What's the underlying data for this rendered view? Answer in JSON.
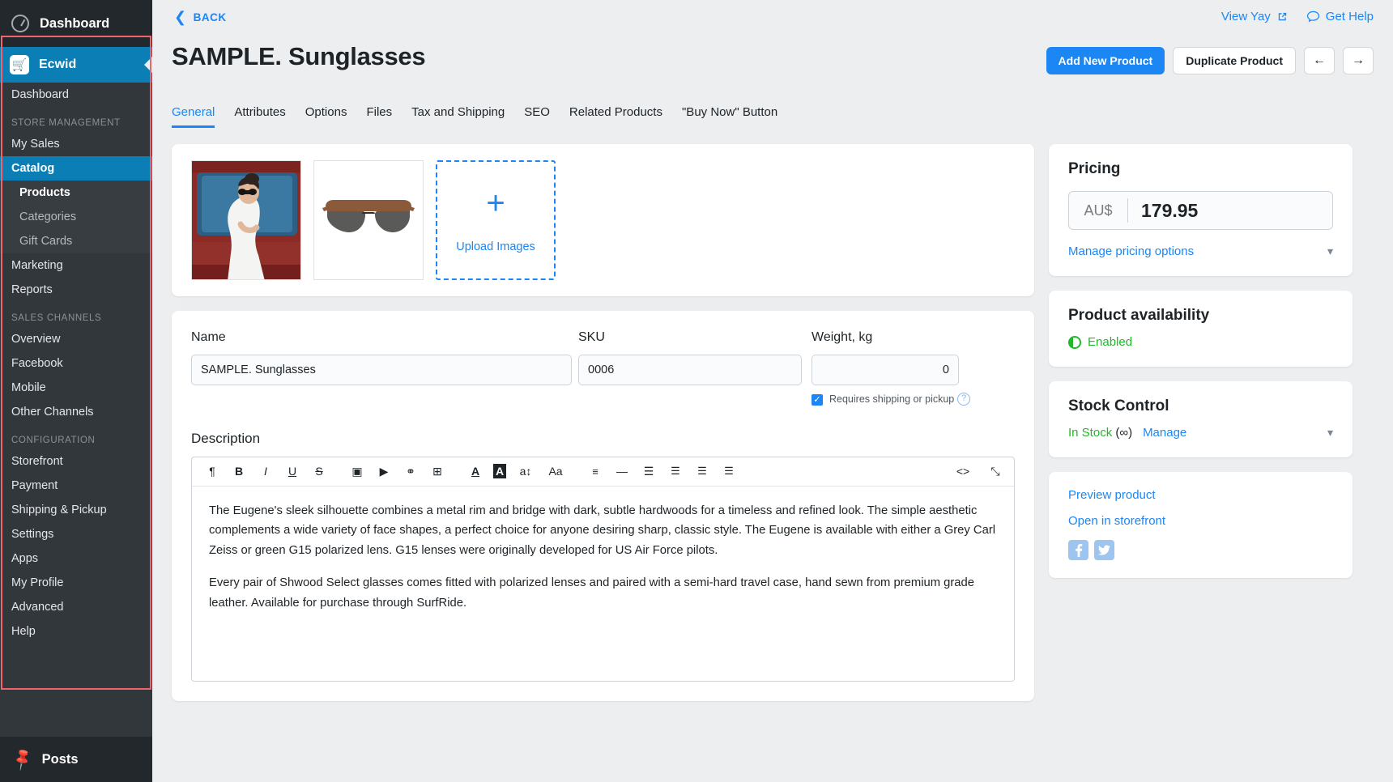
{
  "sidebar": {
    "wp_dashboard": "Dashboard",
    "ecwid": "Ecwid",
    "items": [
      {
        "label": "Dashboard",
        "type": "item"
      },
      {
        "label": "STORE MANAGEMENT",
        "type": "group"
      },
      {
        "label": "My Sales",
        "type": "item"
      },
      {
        "label": "Catalog",
        "type": "selected"
      },
      {
        "label": "Products",
        "type": "sub-active"
      },
      {
        "label": "Categories",
        "type": "sub"
      },
      {
        "label": "Gift Cards",
        "type": "sub"
      },
      {
        "label": "Marketing",
        "type": "item"
      },
      {
        "label": "Reports",
        "type": "item"
      },
      {
        "label": "SALES CHANNELS",
        "type": "group"
      },
      {
        "label": "Overview",
        "type": "item"
      },
      {
        "label": "Facebook",
        "type": "item"
      },
      {
        "label": "Mobile",
        "type": "item"
      },
      {
        "label": "Other Channels",
        "type": "item"
      },
      {
        "label": "CONFIGURATION",
        "type": "group"
      },
      {
        "label": "Storefront",
        "type": "item"
      },
      {
        "label": "Payment",
        "type": "item"
      },
      {
        "label": "Shipping & Pickup",
        "type": "item"
      },
      {
        "label": "Settings",
        "type": "item"
      },
      {
        "label": "Apps",
        "type": "item"
      },
      {
        "label": "My Profile",
        "type": "item"
      },
      {
        "label": "Advanced",
        "type": "item"
      },
      {
        "label": "Help",
        "type": "item"
      }
    ],
    "posts": "Posts",
    "highlight_color": "#f0646b",
    "accent_color": "#0b7fb5"
  },
  "header": {
    "back": "BACK",
    "title": "SAMPLE. Sunglasses",
    "view_store": "View Yay",
    "get_help": "Get Help",
    "add_new_product": "Add New Product",
    "duplicate_product": "Duplicate Product",
    "prev_arrow": "←",
    "next_arrow": "→"
  },
  "tabs": [
    {
      "label": "General",
      "active": true
    },
    {
      "label": "Attributes",
      "active": false
    },
    {
      "label": "Options",
      "active": false
    },
    {
      "label": "Files",
      "active": false
    },
    {
      "label": "Tax and Shipping",
      "active": false
    },
    {
      "label": "SEO",
      "active": false
    },
    {
      "label": "Related Products",
      "active": false
    },
    {
      "label": "\"Buy Now\" Button",
      "active": false
    }
  ],
  "images": {
    "upload_label": "Upload Images",
    "plus": "+"
  },
  "fields": {
    "name_label": "Name",
    "name_value": "SAMPLE. Sunglasses",
    "sku_label": "SKU",
    "sku_value": "0006",
    "weight_label": "Weight, kg",
    "weight_value": "0",
    "requires_shipping": "Requires shipping or pickup",
    "help_glyph": "?",
    "check_glyph": "✓"
  },
  "description": {
    "label": "Description",
    "toolbar": [
      {
        "name": "paragraph-icon",
        "glyph": "¶"
      },
      {
        "name": "bold-icon",
        "glyph": "B"
      },
      {
        "name": "italic-icon",
        "glyph": "I"
      },
      {
        "name": "underline-icon",
        "glyph": "U"
      },
      {
        "name": "strikethrough-icon",
        "glyph": "S"
      },
      {
        "name": "gap",
        "glyph": ""
      },
      {
        "name": "image-icon",
        "glyph": "▣"
      },
      {
        "name": "video-icon",
        "glyph": "▶"
      },
      {
        "name": "link-icon",
        "glyph": "⚭"
      },
      {
        "name": "table-icon",
        "glyph": "⊞"
      },
      {
        "name": "gap",
        "glyph": ""
      },
      {
        "name": "text-color-icon",
        "glyph": "A"
      },
      {
        "name": "highlight-color-icon",
        "glyph": "A"
      },
      {
        "name": "font-size-icon",
        "glyph": "a↕"
      },
      {
        "name": "font-family-icon",
        "glyph": "Aa"
      },
      {
        "name": "gap",
        "glyph": ""
      },
      {
        "name": "align-icon",
        "glyph": "≡"
      },
      {
        "name": "horizontal-rule-icon",
        "glyph": "—"
      },
      {
        "name": "bullet-list-icon",
        "glyph": "☰"
      },
      {
        "name": "numbered-list-icon",
        "glyph": "☰"
      },
      {
        "name": "outdent-icon",
        "glyph": "☰"
      },
      {
        "name": "indent-icon",
        "glyph": "☰"
      }
    ],
    "source_code": "<>",
    "fullscreen": "⤡",
    "paragraphs": [
      "The Eugene's sleek silhouette combines a metal rim and bridge with dark, subtle hardwoods for a timeless and refined look. The simple aesthetic complements a wide variety of face shapes, a perfect choice for anyone desiring sharp, classic style. The Eugene is available with either a Grey Carl Zeiss or green G15 polarized lens. G15 lenses were originally developed for US Air Force pilots.",
      "Every pair of Shwood Select glasses comes fitted with polarized lenses and paired with a semi-hard travel case, hand sewn from premium grade leather. Available for purchase through SurfRide."
    ]
  },
  "pricing": {
    "title": "Pricing",
    "currency": "AU$",
    "value": "179.95",
    "manage_link": "Manage pricing options"
  },
  "availability": {
    "title": "Product availability",
    "status": "Enabled",
    "status_color": "#21b82a"
  },
  "stock": {
    "title": "Stock Control",
    "status": "In Stock",
    "qty": "(∞)",
    "manage": "Manage"
  },
  "links": {
    "preview": "Preview product",
    "storefront": "Open in storefront",
    "facebook": "f",
    "twitter": "🐦"
  }
}
